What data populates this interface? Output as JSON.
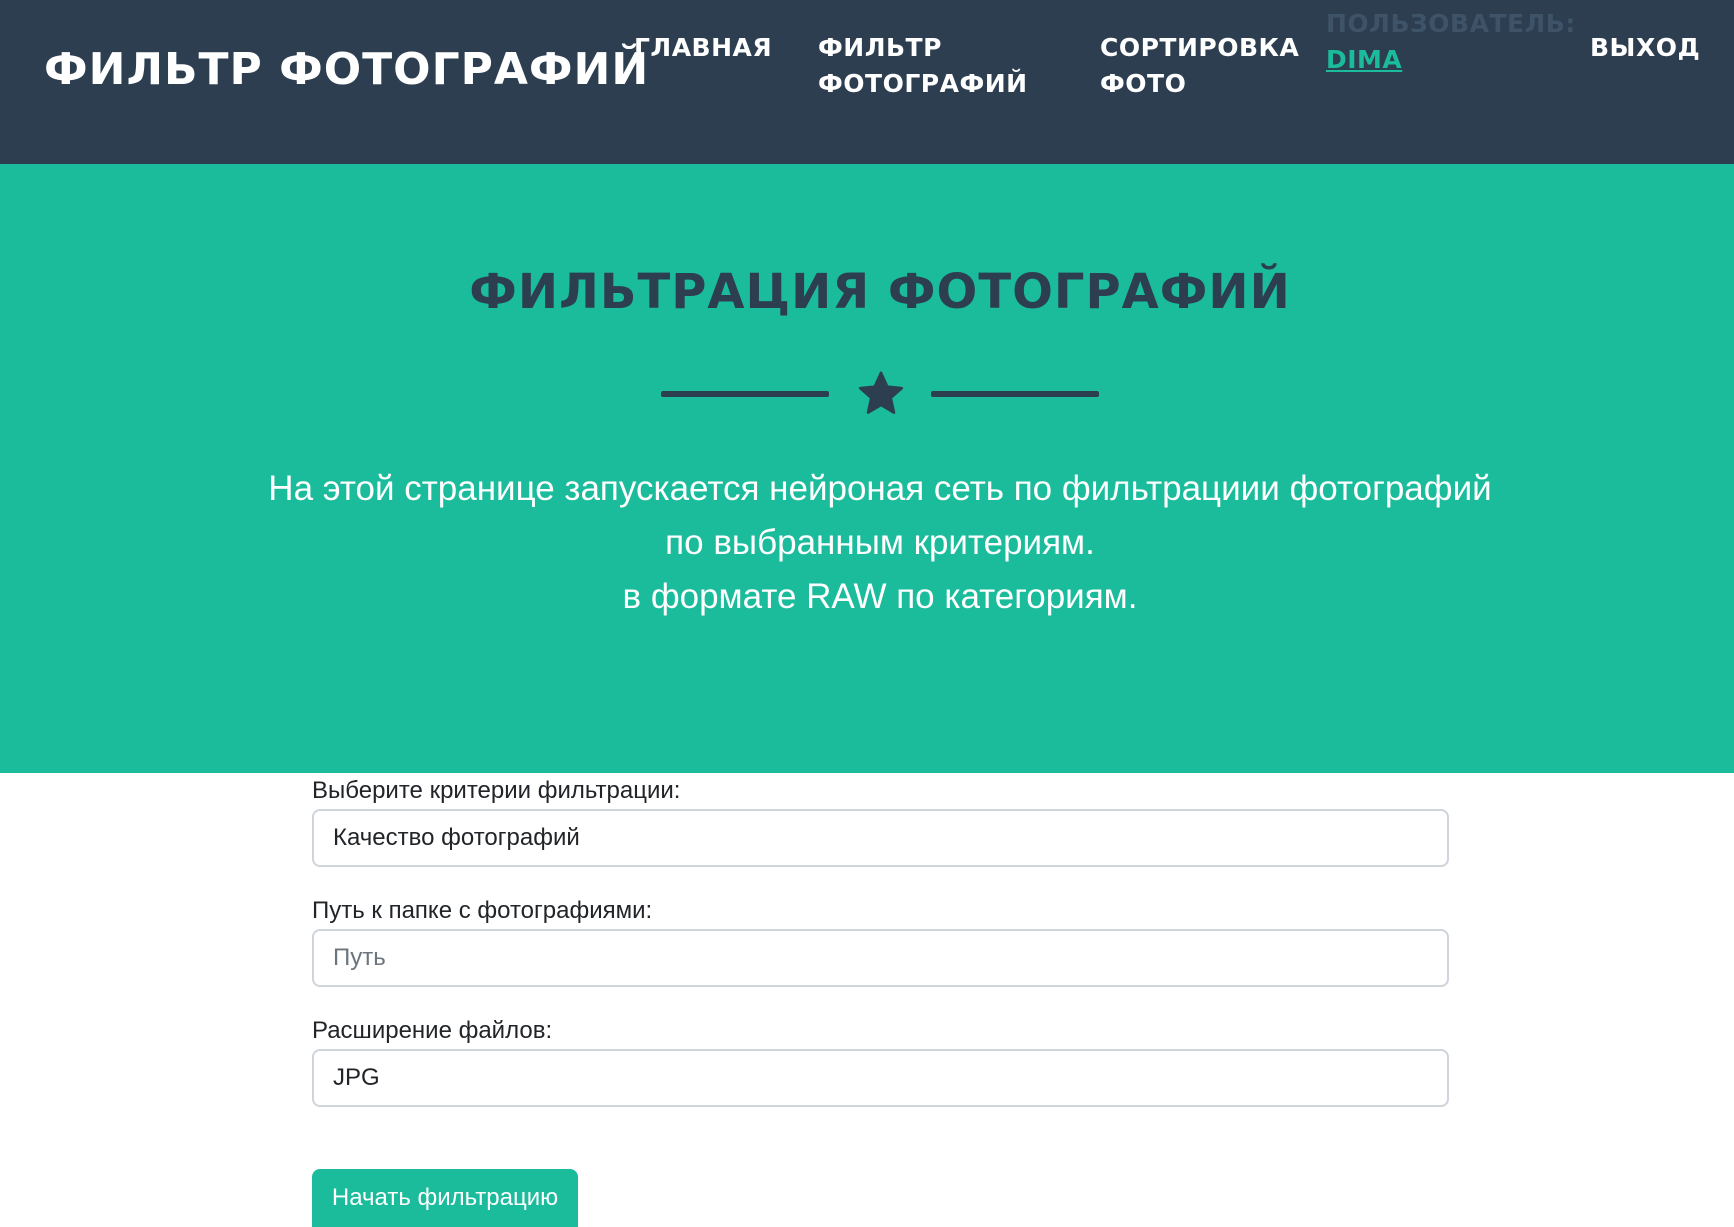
{
  "navbar": {
    "brand": "ФИЛЬТР ФОТОГРАФИЙ",
    "items": [
      {
        "label": "ГЛАВНАЯ"
      },
      {
        "label": "ФИЛЬТР ФОТОГРАФИЙ"
      },
      {
        "label": "СОРТИРОВКА ФОТО"
      }
    ],
    "user_label": "ПОЛЬЗОВАТЕЛЬ:",
    "user_name": "DIMA",
    "logout": "ВЫХОД"
  },
  "masthead": {
    "title": "ФИЛЬТРАЦИЯ ФОТОГРАФИЙ",
    "divider_icon": "star-icon",
    "lines": [
      "На этой странице запускается нейроная сеть по фильтрациии фотографий",
      "по выбранным критериям.",
      "в формате RAW по категориям."
    ]
  },
  "form": {
    "criteria_label": "Выберите критерии фильтрации:",
    "criteria_value": "Качество фотографий",
    "path_label": "Путь к папке с фотографиями:",
    "path_value": "",
    "path_placeholder": "Путь",
    "ext_label": "Расширение файлов:",
    "ext_value": "JPG",
    "submit_label": "Начать фильтрацию"
  },
  "colors": {
    "navbar_bg": "#2c3e50",
    "accent": "#1abc9c",
    "text_light": "#ffffff"
  }
}
